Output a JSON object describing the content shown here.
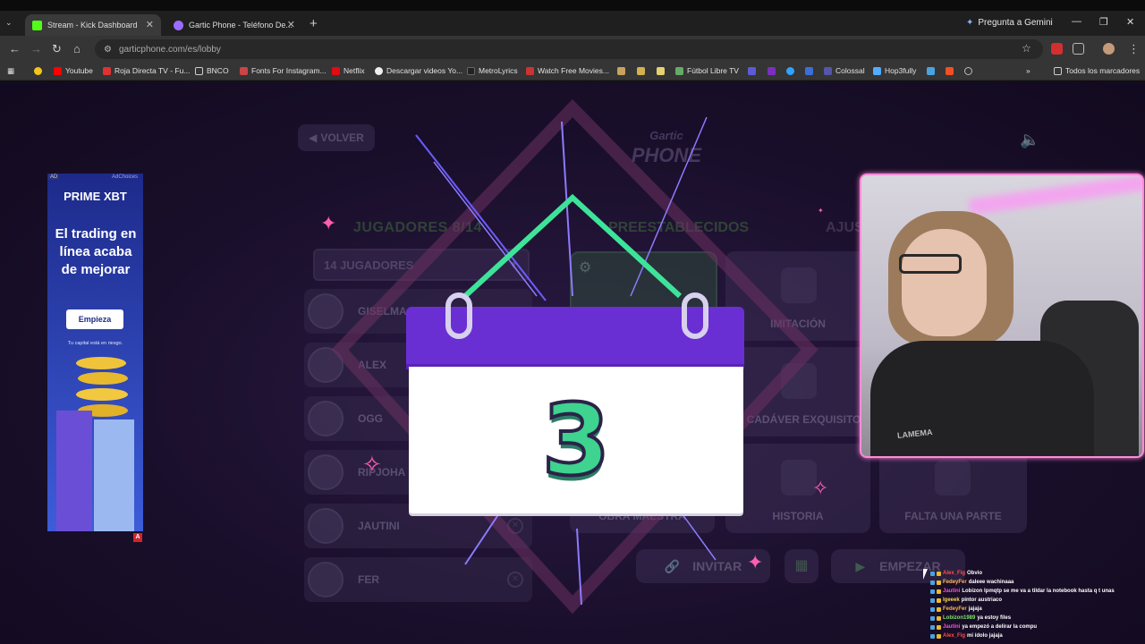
{
  "browser": {
    "tabs": [
      {
        "title": "Stream - Kick Dashboard",
        "favicon": "kick-icon",
        "color": "#53fc18"
      },
      {
        "title": "Gartic Phone - Teléfono De...",
        "favicon": "gartic-icon",
        "color": "#9a6cff",
        "audio": "speaker-icon"
      }
    ],
    "gemini_label": "Pregunta a Gemini",
    "url": "garticphone.com/es/lobby",
    "bookmarks": [
      {
        "label": "Youtube",
        "color": "#ff0000"
      },
      {
        "label": "Roja Directa TV - Fu...",
        "color": "#d33"
      },
      {
        "label": "BNCO",
        "color": "#888"
      },
      {
        "label": "Fonts For Instagram...",
        "color": "#c44"
      },
      {
        "label": "Netflix",
        "color": "#e50914"
      },
      {
        "label": "Descargar videos Yo...",
        "color": "#eee"
      },
      {
        "label": "MetroLyrics",
        "color": "#222"
      },
      {
        "label": "Watch Free Movies...",
        "color": "#c33"
      },
      {
        "label": "Fútbol Libre TV",
        "color": "#6a6"
      },
      {
        "label": "Colossal",
        "color": "#55a"
      },
      {
        "label": "Hop3fully",
        "color": "#5af"
      },
      {
        "label": "Todos los marcadores",
        "color": "#999"
      }
    ]
  },
  "game": {
    "back_label": "VOLVER",
    "logo_top": "Gartic",
    "logo_bottom": "PHONE",
    "players_title": "JUGADORES 8/14",
    "players_select": "14 JUGADORES",
    "players": [
      "GISELMA",
      "ALEX",
      "OGG",
      "RIPJOHA",
      "JAUTINI",
      "FER"
    ],
    "presets_title": "PREESTABLECIDOS",
    "adjust_title": "AJUS",
    "modes": [
      "IMITACIÓN",
      "CADÁVER EXQUISITO",
      "HISTORIA",
      "FALTA UNA PARTE",
      "OBRA MAESTRA"
    ],
    "invite_label": "INVITAR",
    "start_label": "EMPEZAR",
    "countdown": "3"
  },
  "ad": {
    "tag": "AD",
    "choices": "AdChoices",
    "brand": "PRIME XBT",
    "headline": "El trading en línea acaba de mejorar",
    "cta": "Empieza",
    "disclaimer": "Tu capital está en riesgo."
  },
  "webcam": {
    "shirt_text": "LAMEMA"
  },
  "chat": [
    {
      "user": "Alex_Fig",
      "user_color": "#ff4d4d",
      "msg": "Obvio"
    },
    {
      "user": "FedeyFer",
      "user_color": "#ffb347",
      "msg": "daleee wachinaaa"
    },
    {
      "user": "Jautini",
      "user_color": "#ff4dd2",
      "msg": "Lobizon lpmqtp se me va a tildar la notebook hasta q t unas"
    },
    {
      "user": "lgeeek",
      "user_color": "#ffd84d",
      "msg": "pintor austriaco"
    },
    {
      "user": "FedeyFer",
      "user_color": "#ffb347",
      "msg": "jajaja"
    },
    {
      "user": "Lobizon1989",
      "user_color": "#7ee36b",
      "msg": "ya estoy files"
    },
    {
      "user": "Jautini",
      "user_color": "#ff4dd2",
      "msg": "ya empezó a delirar la compu"
    },
    {
      "user": "Alex_Fig",
      "user_color": "#ff4d4d",
      "msg": "mi ídolo jajaja"
    }
  ]
}
